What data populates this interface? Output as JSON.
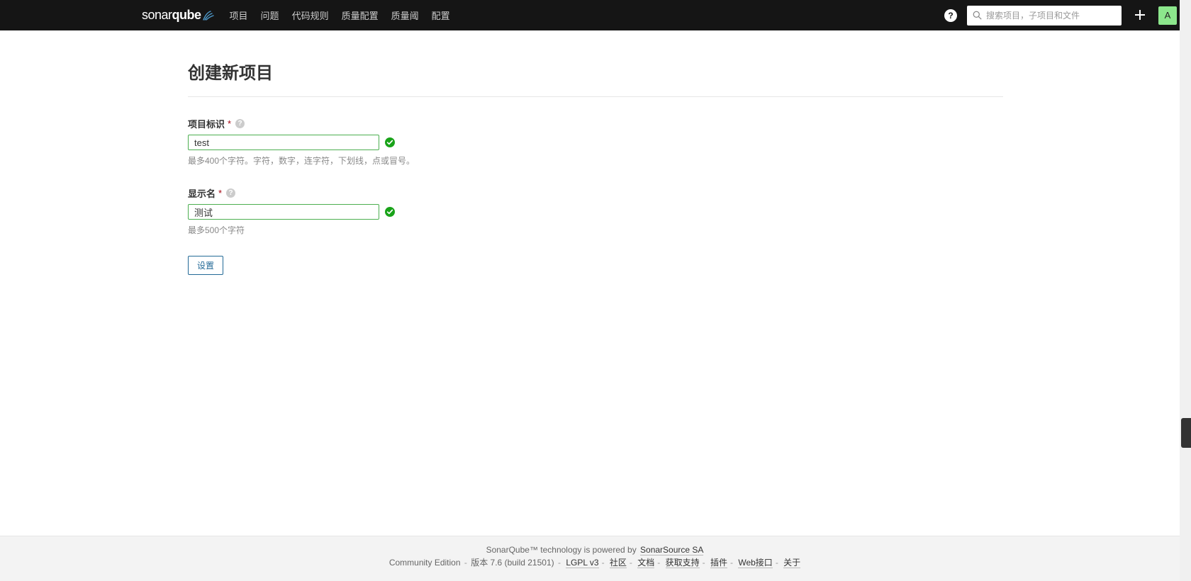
{
  "brand": {
    "part1": "sonar",
    "part2": "qube"
  },
  "nav": {
    "items": [
      {
        "label": "项目"
      },
      {
        "label": "问题"
      },
      {
        "label": "代码规则"
      },
      {
        "label": "质量配置"
      },
      {
        "label": "质量阈"
      },
      {
        "label": "配置"
      }
    ]
  },
  "search": {
    "placeholder": "搜索项目，子项目和文件"
  },
  "user": {
    "initial": "A"
  },
  "page": {
    "title": "创建新项目",
    "submit_label": "设置"
  },
  "fields": {
    "project_key": {
      "label": "项目标识",
      "value": "test",
      "hint": "最多400个字符。字符，数字，连字符，下划线，点或冒号。"
    },
    "display_name": {
      "label": "显示名",
      "value": "测试",
      "hint": "最多500个字符"
    }
  },
  "footer": {
    "line1_pre": "SonarQube™ technology is powered by ",
    "line1_link": "SonarSource SA",
    "edition": "Community Edition",
    "version": "版本 7.6 (build 21501)",
    "links": [
      {
        "label": "LGPL v3"
      },
      {
        "label": "社区"
      },
      {
        "label": "文档"
      },
      {
        "label": "获取支持"
      },
      {
        "label": "插件"
      },
      {
        "label": "Web接口"
      },
      {
        "label": "关于"
      }
    ]
  }
}
